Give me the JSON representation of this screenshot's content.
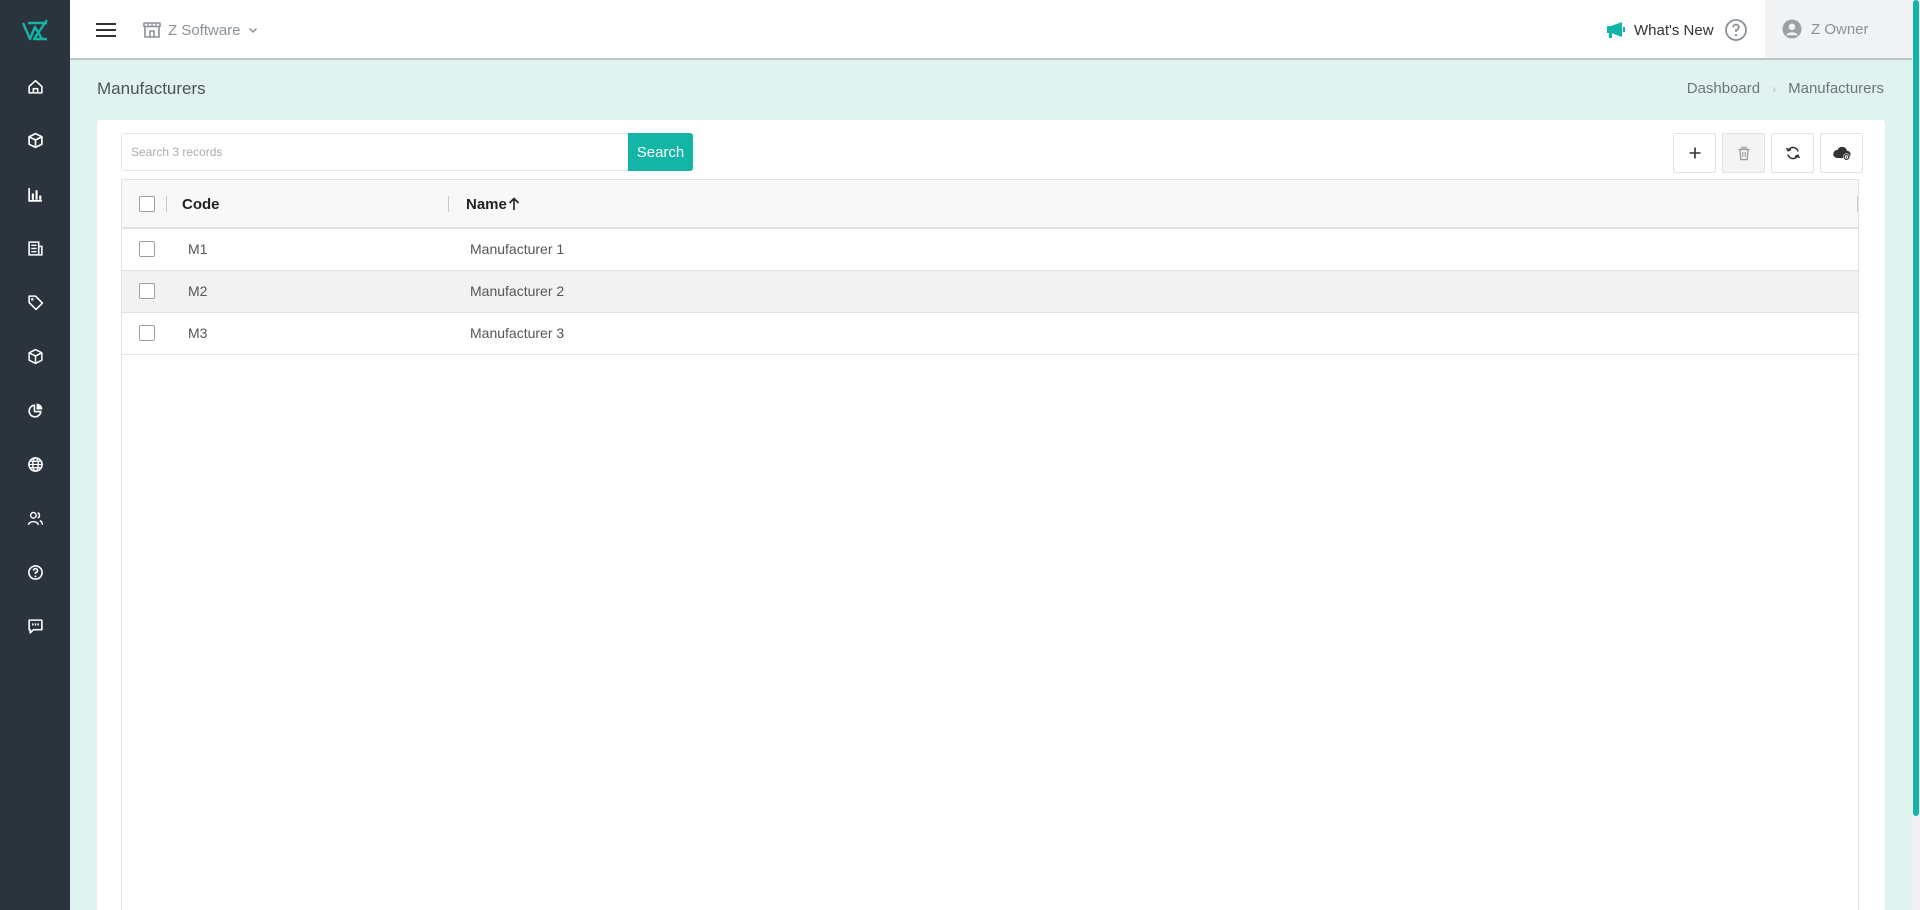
{
  "header": {
    "company_name": "Z Software",
    "whats_new_label": "What's New",
    "user_name": "Z Owner"
  },
  "sidebar": {
    "items": [
      {
        "icon": "home-icon"
      },
      {
        "icon": "box-icon"
      },
      {
        "icon": "bar-chart-icon"
      },
      {
        "icon": "report-icon"
      },
      {
        "icon": "tag-icon"
      },
      {
        "icon": "package-icon"
      },
      {
        "icon": "pie-chart-icon"
      },
      {
        "icon": "globe-icon"
      },
      {
        "icon": "users-icon"
      },
      {
        "icon": "help-icon"
      },
      {
        "icon": "feedback-icon"
      }
    ]
  },
  "page": {
    "title": "Manufacturers",
    "breadcrumb": [
      "Dashboard",
      "Manufacturers"
    ]
  },
  "toolbar": {
    "search_placeholder": "Search 3 records",
    "search_label": "Search"
  },
  "table": {
    "columns": [
      "Code",
      "Name"
    ],
    "sort": {
      "column": "Name",
      "direction": "ascending"
    },
    "rows": [
      {
        "code": "M1",
        "name": "Manufacturer 1"
      },
      {
        "code": "M2",
        "name": "Manufacturer 2"
      },
      {
        "code": "M3",
        "name": "Manufacturer 3"
      }
    ]
  },
  "colors": {
    "accent": "#12b5a6",
    "sidebar": "#2b333c",
    "page_background": "#e0f3f1"
  }
}
